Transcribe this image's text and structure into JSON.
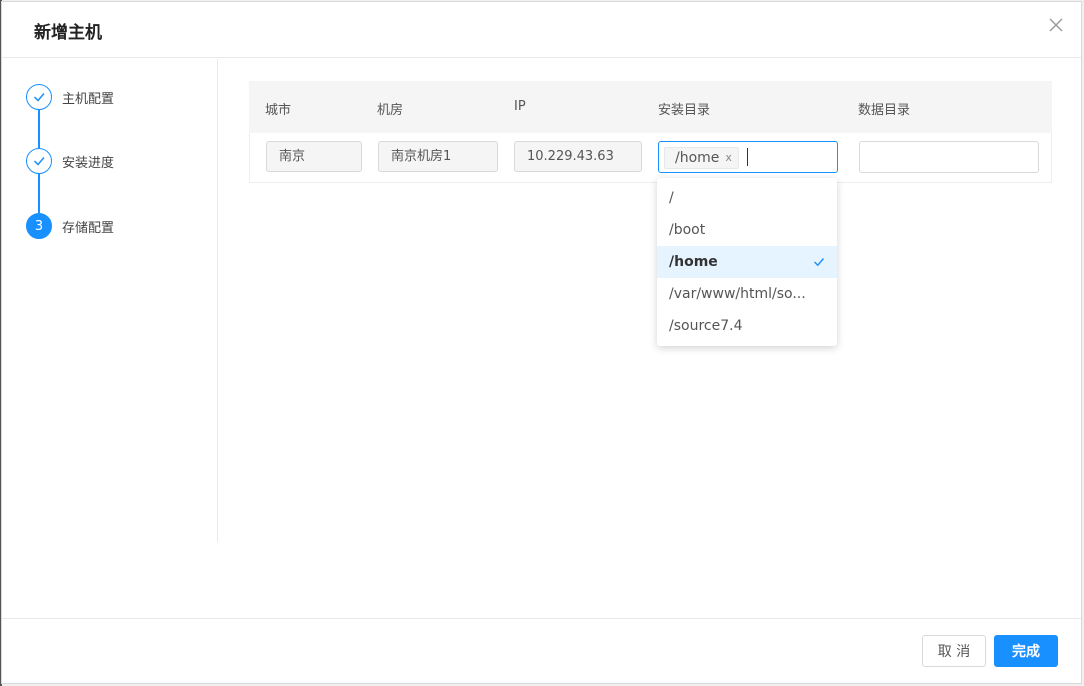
{
  "modal": {
    "title": "新增主机"
  },
  "steps": [
    {
      "label": "主机配置",
      "status": "done"
    },
    {
      "label": "安装进度",
      "status": "done"
    },
    {
      "label": "存储配置",
      "status": "active",
      "number": "3"
    }
  ],
  "table": {
    "headers": [
      "城市",
      "机房",
      "IP",
      "安装目录",
      "数据目录"
    ],
    "row": {
      "city": "南京",
      "room": "南京机房1",
      "ip": "10.229.43.63",
      "install_dir_tag": "/home",
      "tag_close": "x",
      "data_dir": ""
    }
  },
  "dropdown": {
    "options": [
      "/",
      "/boot",
      "/home",
      "/var/www/html/so...",
      "/source7.4"
    ],
    "selected": "/home"
  },
  "footer": {
    "cancel_label": "取 消",
    "ok_label": "完成"
  },
  "colors": {
    "accent": "#1890ff",
    "selected_bg": "#e6f4ff"
  }
}
